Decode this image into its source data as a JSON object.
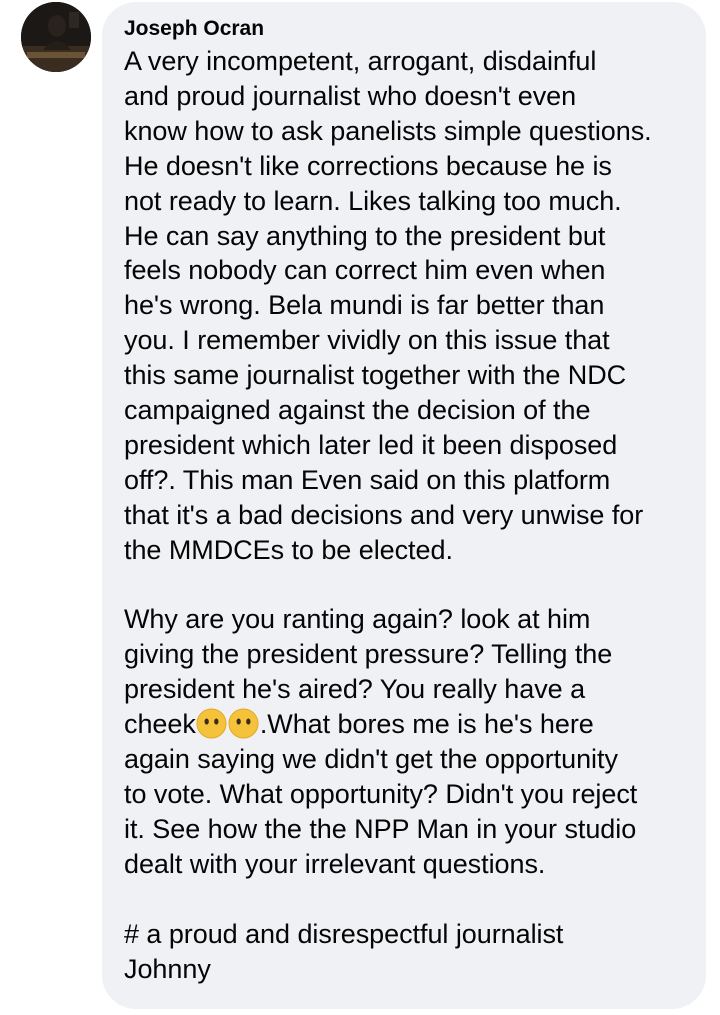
{
  "comment": {
    "author": "Joseph Ocran",
    "paragraph1": [
      "A very incompetent, arrogant, disdainful",
      "and  proud journalist who doesn't even",
      "know how to ask panelists simple questions.",
      "He doesn't like corrections because he is",
      "not ready to learn. Likes talking too much.",
      "He can say anything to the president but",
      "feels nobody can correct him even when",
      "he's wrong. Bela mundi is far better than",
      "you. I remember vividly on this issue that",
      "this same journalist together with the NDC",
      "campaigned against the decision of the",
      "president which later led it been disposed",
      "off?. This man Even said on this platform",
      "that it's a bad decisions and very unwise for",
      "the MMDCEs to be elected."
    ],
    "paragraph2": {
      "lines_before": [
        "Why are you ranting again? look at him",
        "giving the president pressure? Telling the",
        "president he's aired? You really have a"
      ],
      "emoji_line_prefix": "cheek",
      "emoji_names": [
        "face-without-mouth-emoji",
        "face-without-mouth-emoji"
      ],
      "emoji_line_suffix": ".What bores me is he's here",
      "lines_after": [
        "again saying we didn't get the opportunity",
        "to vote. What opportunity? Didn't you reject",
        "it. See how the the NPP Man in your studio",
        "dealt with your irrelevant questions."
      ]
    },
    "paragraph3": [
      "# a proud and disrespectful journalist",
      "Johnny"
    ]
  },
  "colors": {
    "bubble_background": "#eff1f4",
    "text": "#050505",
    "emoji_face": "#f5c33b"
  }
}
